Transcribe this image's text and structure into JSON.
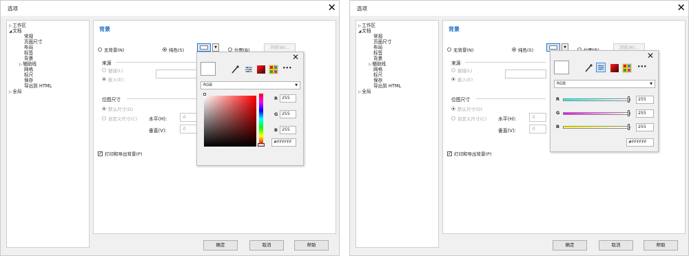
{
  "dialog": {
    "title": "选项",
    "close_glyph": "✕",
    "tree": {
      "workspace": "工作区",
      "document": "文档",
      "general": "常规",
      "page_size": "页面尺寸",
      "layout": "布局",
      "label": "标签",
      "background": "背景",
      "guides": "辅助线",
      "grid": "网格",
      "rulers": "标尺",
      "save": "保存",
      "export_html": "导出到 HTML",
      "global": "全局"
    },
    "section_title": "背景",
    "no_background": "无背景(N)",
    "solid": "纯色(S)",
    "bitmap": "位图(B)",
    "browse": "浏览(W)...",
    "source_group": "来源",
    "link": "链接(L)",
    "embed": "嵌入(E)",
    "bitmap_size_group": "位图尺寸",
    "default_size": "默认尺寸(D)",
    "custom_size": "自定义尺寸(C)",
    "horizontal": "水平(H):",
    "vertical": "垂直(V):",
    "box_stub": ".0",
    "print_export": "打印和导出背景(P)",
    "ok": "确定",
    "cancel": "取消",
    "help": "帮助"
  },
  "popup": {
    "close_glyph": "✕",
    "color_model": "RGB",
    "r_label": "R",
    "g_label": "G",
    "b_label": "B",
    "r_value": "255",
    "g_value": "255",
    "b_value": "255",
    "hex": "#FFFFFF",
    "more": "•••"
  },
  "colors": {
    "accent": "#1a6fc4",
    "current_color": "#FFFFFF"
  }
}
